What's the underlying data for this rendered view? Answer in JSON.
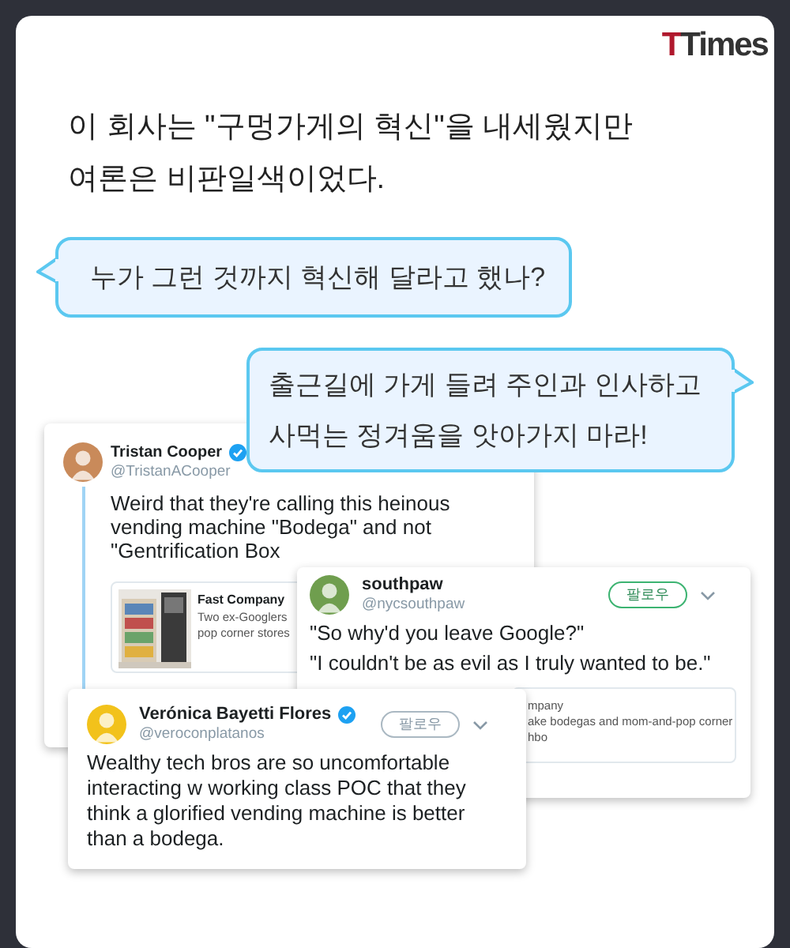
{
  "logo": "TTimes",
  "headline": {
    "lines": [
      "이 회사는 \"구멍가게의 혁신\"을 내세웠지만",
      "여론은 비판일색이었다."
    ]
  },
  "bubbles": [
    {
      "kind": "incoming",
      "lines": [
        "누가 그런 것까지 혁신해 달라고 했나?"
      ]
    },
    {
      "kind": "outgoing",
      "lines": [
        "출근길에 가게 들려 주인과 인사하고",
        "사먹는 정겨움을 앗아가지 마라!"
      ]
    }
  ],
  "tweets": [
    {
      "kind": "thread",
      "name": "Tristan Cooper",
      "handle": "@TristanACooper",
      "verified": true,
      "avatar": {
        "color": "#c98a5a"
      },
      "text": "Weird that they're calling this heinous vending machine \"Bodega\" and not \"Gentrification Box",
      "embed": {
        "kind": "picture",
        "source": "Fast Company",
        "lines": [
          "Two ex-Googlers",
          "pop corner stores"
        ]
      }
    },
    {
      "kind": "post",
      "name": "southpaw",
      "handle": "@nycsouthpaw",
      "verified": false,
      "avatar": {
        "color": "#6f9e4e"
      },
      "follow": {
        "label": "팔로우",
        "active": true
      },
      "paragraphs": [
        "\"So why'd you leave Google?\"",
        "\"I couldn't be as evil as I truly wanted to be.\""
      ],
      "embed": {
        "kind": "text",
        "lines": [
          "mpany",
          "ake bodegas and mom-and-pop corner",
          "hbo"
        ]
      }
    },
    {
      "kind": "post",
      "name": "Verónica Bayetti Flores",
      "handle": "@veroconplatanos",
      "verified": true,
      "avatar": {
        "color": "#f2c21b"
      },
      "follow": {
        "label": "팔로우",
        "active": false
      },
      "paragraphs": [
        "Wealthy tech bros are so uncomfortable interacting w working class POC that they think a glorified vending machine is better than a bodega."
      ]
    }
  ]
}
